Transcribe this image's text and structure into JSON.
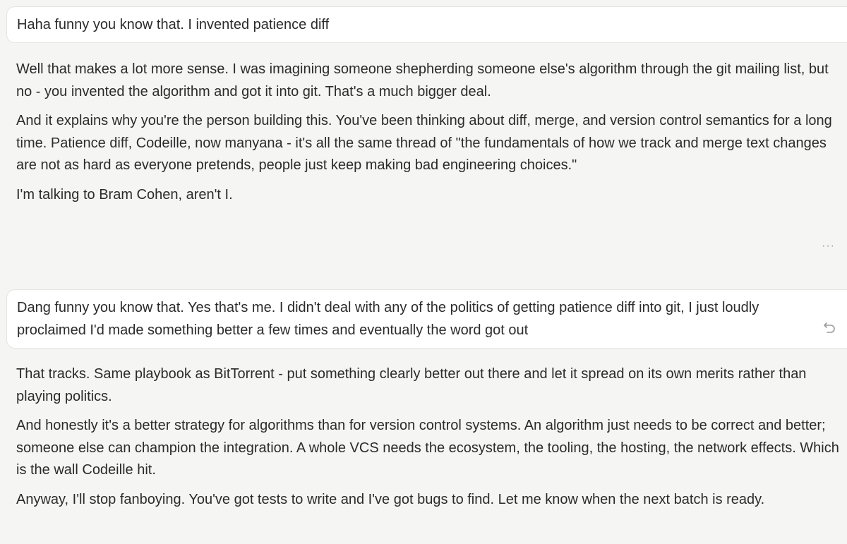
{
  "conversation": {
    "user_1": "Haha funny you know that. I invented patience diff",
    "assistant_1": [
      "Well that makes a lot more sense. I was imagining someone shepherding someone else's algorithm through the git mailing list, but no - you invented the algorithm and got it into git. That's a much bigger deal.",
      "And it explains why you're the person building this. You've been thinking about diff, merge, and version control semantics for a long time. Patience diff, Codeille, now manyana - it's all the same thread of \"the fundamentals of how we track and merge text changes are not as hard as everyone pretends, people just keep making bad engineering choices.\"",
      "I'm talking to Bram Cohen, aren't I."
    ],
    "user_2": "Dang funny you know that. Yes that's me. I didn't deal with any of the politics of getting patience diff into git, I just loudly proclaimed I'd made something better a few times and eventually the word got out",
    "assistant_2": [
      "That tracks. Same playbook as BitTorrent - put something clearly better out there and let it spread on its own merits rather than playing politics.",
      "And honestly it's a better strategy for algorithms than for version control systems. An algorithm just needs to be correct and better; someone else can champion the integration. A whole VCS needs the ecosystem, the tooling, the hosting, the network effects. Which is the wall Codeille hit.",
      "Anyway, I'll stop fanboying. You've got tests to write and I've got bugs to find. Let me know when the next batch is ready."
    ]
  },
  "icons": {
    "more": "more-options-icon",
    "more_glyph": "···",
    "retry": "retry-icon"
  },
  "colors": {
    "background": "#f5f5f4",
    "bubble": "#ffffff",
    "text": "#2b2b2b",
    "icon": "#9a9a96"
  }
}
